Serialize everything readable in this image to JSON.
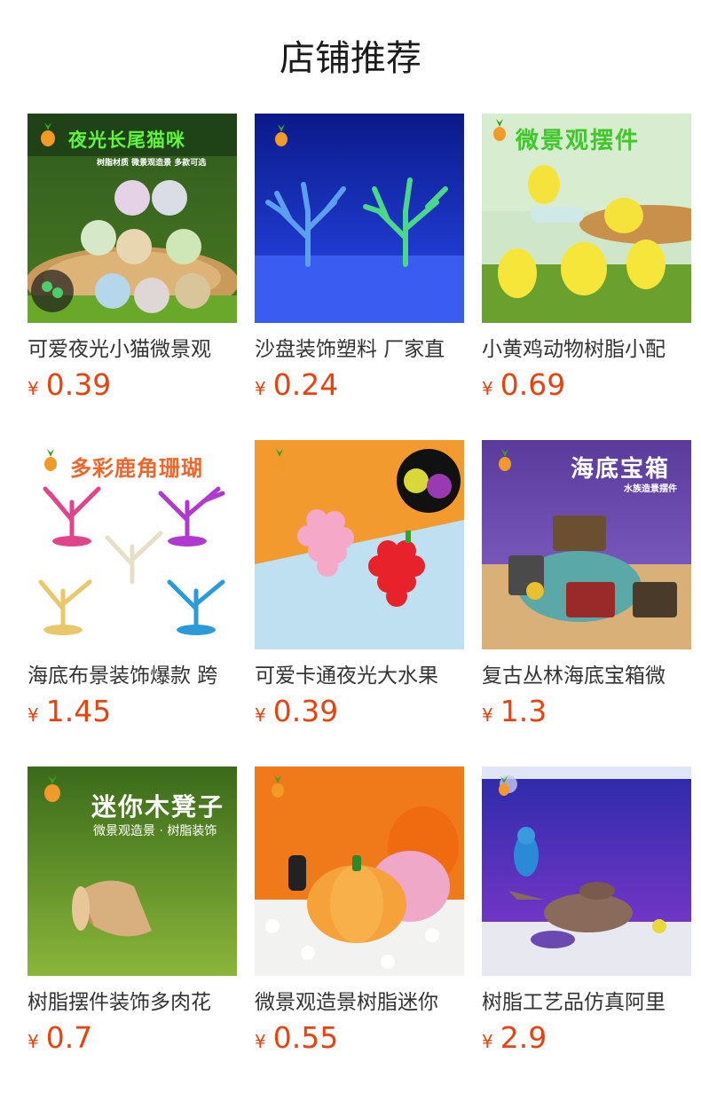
{
  "page": {
    "title": "店铺推荐"
  },
  "colors": {
    "price": "#e8420e",
    "title": "#1a1a1a",
    "name": "#333333"
  },
  "products": [
    {
      "name": "可爱夜光小猫微景观",
      "currency": "¥",
      "price": "0.39",
      "image": {
        "banner": "夜光长尾猫咪",
        "sub": "树脂材质 微景观造景 多款可选",
        "theme": "glow-cats"
      }
    },
    {
      "name": "沙盘装饰塑料 厂家直",
      "currency": "¥",
      "price": "0.24",
      "image": {
        "theme": "glow-coral"
      }
    },
    {
      "name": "小黄鸡动物树脂小配",
      "currency": "¥",
      "price": "0.69",
      "image": {
        "banner": "微景观摆件",
        "theme": "yellow-chicks"
      }
    },
    {
      "name": "海底布景装饰爆款 跨",
      "currency": "¥",
      "price": "1.45",
      "image": {
        "banner": "多彩鹿角珊瑚",
        "theme": "antler-coral"
      }
    },
    {
      "name": "可爱卡通夜光大水果",
      "currency": "¥",
      "price": "0.39",
      "image": {
        "theme": "grapes"
      }
    },
    {
      "name": "复古丛林海底宝箱微",
      "currency": "¥",
      "price": "1.3",
      "image": {
        "banner": "海底宝箱",
        "sub": "水族造景摆件",
        "theme": "treasure-chest"
      }
    },
    {
      "name": "树脂摆件装饰多肉花",
      "currency": "¥",
      "price": "0.7",
      "image": {
        "banner": "迷你木凳子",
        "sub": "微景观造景 · 树脂装饰",
        "theme": "wood-bench"
      }
    },
    {
      "name": "微景观造景树脂迷你",
      "currency": "¥",
      "price": "0.55",
      "image": {
        "theme": "pumpkin"
      }
    },
    {
      "name": "树脂工艺品仿真阿里",
      "currency": "¥",
      "price": "2.9",
      "image": {
        "theme": "magic-lamp"
      }
    }
  ]
}
